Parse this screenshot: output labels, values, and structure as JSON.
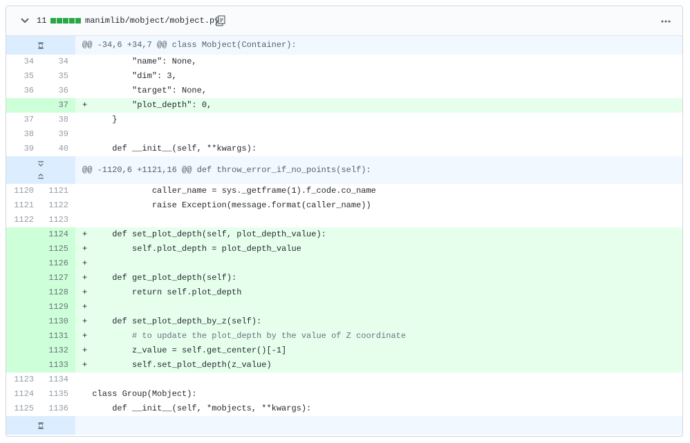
{
  "header": {
    "change_count": "11",
    "file_path": "manimlib/mobject/mobject.py",
    "block_color": "#28a745"
  },
  "hunks": [
    {
      "header": "@@ -34,6 +34,7 @@ class Mobject(Container):"
    },
    {
      "header": "@@ -1120,6 +1121,16 @@ def throw_error_if_no_points(self):"
    }
  ],
  "lines": [
    {
      "old": "34",
      "new": "34",
      "sign": " ",
      "code": "        \"name\": None,"
    },
    {
      "old": "35",
      "new": "35",
      "sign": " ",
      "code": "        \"dim\": 3,"
    },
    {
      "old": "36",
      "new": "36",
      "sign": " ",
      "code": "        \"target\": None,"
    },
    {
      "old": "",
      "new": "37",
      "sign": "+",
      "code": "        \"plot_depth\": 0,"
    },
    {
      "old": "37",
      "new": "38",
      "sign": " ",
      "code": "    }"
    },
    {
      "old": "38",
      "new": "39",
      "sign": " ",
      "code": ""
    },
    {
      "old": "39",
      "new": "40",
      "sign": " ",
      "code": "    def __init__(self, **kwargs):"
    },
    {
      "old": "1120",
      "new": "1121",
      "sign": " ",
      "code": "            caller_name = sys._getframe(1).f_code.co_name"
    },
    {
      "old": "1121",
      "new": "1122",
      "sign": " ",
      "code": "            raise Exception(message.format(caller_name))"
    },
    {
      "old": "1122",
      "new": "1123",
      "sign": " ",
      "code": ""
    },
    {
      "old": "",
      "new": "1124",
      "sign": "+",
      "code": "    def set_plot_depth(self, plot_depth_value):"
    },
    {
      "old": "",
      "new": "1125",
      "sign": "+",
      "code": "        self.plot_depth = plot_depth_value"
    },
    {
      "old": "",
      "new": "1126",
      "sign": "+",
      "code": ""
    },
    {
      "old": "",
      "new": "1127",
      "sign": "+",
      "code": "    def get_plot_depth(self):"
    },
    {
      "old": "",
      "new": "1128",
      "sign": "+",
      "code": "        return self.plot_depth"
    },
    {
      "old": "",
      "new": "1129",
      "sign": "+",
      "code": ""
    },
    {
      "old": "",
      "new": "1130",
      "sign": "+",
      "code": "    def set_plot_depth_by_z(self):"
    },
    {
      "old": "",
      "new": "1131",
      "sign": "+",
      "code": "        # to update the plot_depth by the value of Z coordinate"
    },
    {
      "old": "",
      "new": "1132",
      "sign": "+",
      "code": "        z_value = self.get_center()[-1]"
    },
    {
      "old": "",
      "new": "1133",
      "sign": "+",
      "code": "        self.set_plot_depth(z_value)"
    },
    {
      "old": "1123",
      "new": "1134",
      "sign": " ",
      "code": ""
    },
    {
      "old": "1124",
      "new": "1135",
      "sign": " ",
      "code": "class Group(Mobject):"
    },
    {
      "old": "1125",
      "new": "1136",
      "sign": " ",
      "code": "    def __init__(self, *mobjects, **kwargs):"
    }
  ]
}
